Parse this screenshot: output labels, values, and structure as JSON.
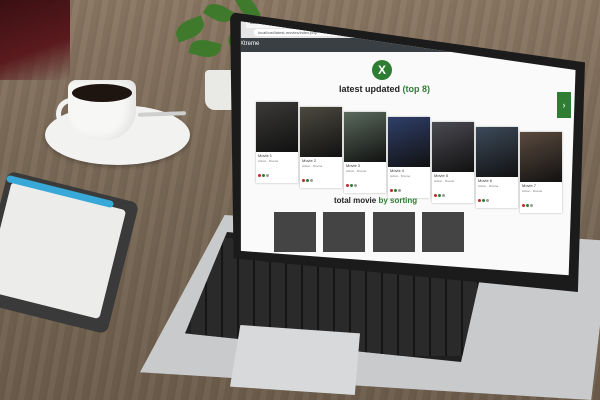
{
  "browser": {
    "tab_title": "latest movies",
    "url": "localhost/latest-movies/index.php"
  },
  "site": {
    "brand": "Xtreme",
    "logo_glyph": "X",
    "latest_heading_prefix": "latest updated",
    "latest_heading_accent": "(top 8)",
    "total_heading_prefix": "total movie",
    "total_heading_accent": "by sorting",
    "next_glyph": "›",
    "accent_color": "#2e7d32"
  },
  "cards": [
    {
      "title": "Movie 1",
      "meta": "Action · Drama"
    },
    {
      "title": "Movie 2",
      "meta": "Action · Drama"
    },
    {
      "title": "Movie 3",
      "meta": "Action · Drama"
    },
    {
      "title": "Movie 4",
      "meta": "Action · Drama"
    },
    {
      "title": "Movie 5",
      "meta": "Action · Drama"
    },
    {
      "title": "Movie 6",
      "meta": "Action · Drama"
    },
    {
      "title": "Movie 7",
      "meta": "Action · Drama"
    }
  ]
}
